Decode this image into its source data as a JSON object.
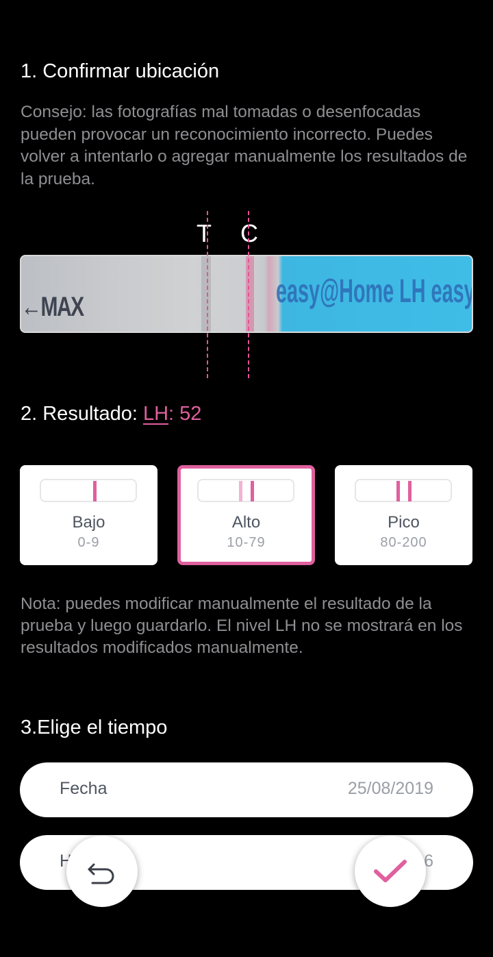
{
  "step1": {
    "title": "1. Confirmar ubicación",
    "tip": "Consejo: las fotografías mal tomadas o desenfocadas pueden provocar un reconocimiento incorrecto. Puedes volver a intentarlo o agregar manualmente los resultados de la prueba."
  },
  "strip": {
    "t_label": "T",
    "c_label": "C",
    "max_text": "←MAX",
    "brand_text": "easy@Home  LH   easy@Home  LH"
  },
  "step2": {
    "prefix": "2. Resultado: ",
    "lh_label": "LH",
    "separator": ": ",
    "lh_value": "52"
  },
  "levels": [
    {
      "name": "Bajo",
      "range": "0-9"
    },
    {
      "name": "Alto",
      "range": "10-79",
      "selected": true
    },
    {
      "name": "Pico",
      "range": "80-200"
    }
  ],
  "note": "Nota: puedes modificar manualmente el resultado de la prueba y luego guardarlo. El nivel LH no se mostrará en los resultados modificados manualmente.",
  "step3": {
    "title": "3.Elige el tiempo",
    "date_label": "Fecha",
    "date_value": "25/08/2019",
    "time_label_partial": "H",
    "time_value_partial": "6"
  },
  "icons": {
    "undo": "undo-icon",
    "confirm": "check-icon"
  },
  "colors": {
    "accent": "#e0609e",
    "background": "#000000",
    "muted_text": "#8f8f93"
  }
}
